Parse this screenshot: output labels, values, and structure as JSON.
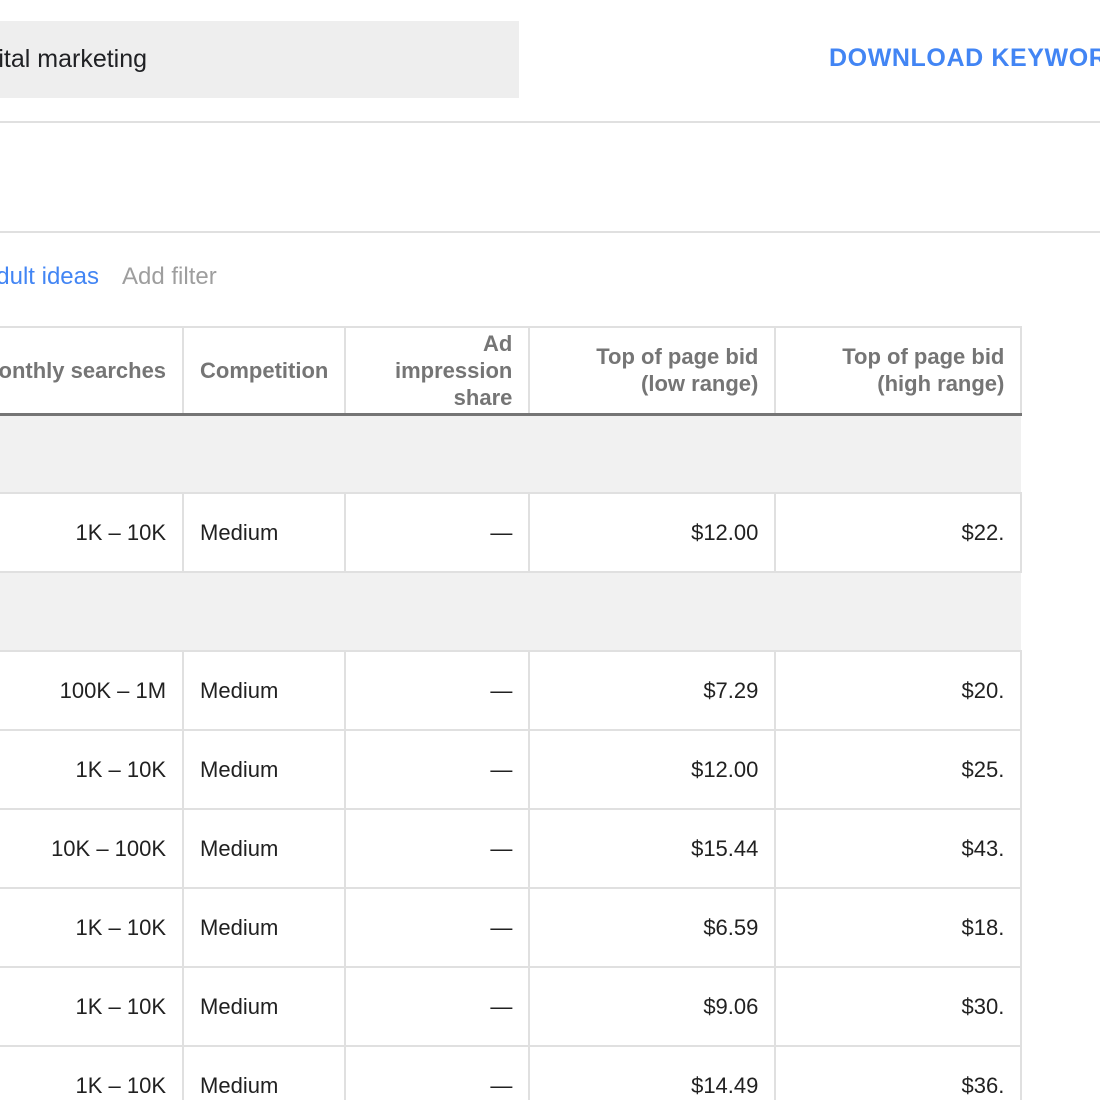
{
  "search": {
    "value": "digital marketing"
  },
  "toolbar": {
    "download_label": "DOWNLOAD KEYWORD IDEAS"
  },
  "filters": {
    "active_chip": "Exclude adult ideas",
    "add_filter_label": "Add filter"
  },
  "table": {
    "headers": {
      "searches": "Avg. monthly searches",
      "competition": "Competition",
      "impression_share": "Ad impression share",
      "bid_low": "Top of page bid (low range)",
      "bid_high": "Top of page bid (high range)"
    },
    "rows": [
      {
        "type": "group"
      },
      {
        "type": "data",
        "searches": "1K – 10K",
        "competition": "Medium",
        "impression_share": "—",
        "bid_low": "$12.00",
        "bid_high": "$22."
      },
      {
        "type": "group"
      },
      {
        "type": "data",
        "searches": "100K – 1M",
        "competition": "Medium",
        "impression_share": "—",
        "bid_low": "$7.29",
        "bid_high": "$20."
      },
      {
        "type": "data",
        "searches": "1K – 10K",
        "competition": "Medium",
        "impression_share": "—",
        "bid_low": "$12.00",
        "bid_high": "$25."
      },
      {
        "type": "data",
        "searches": "10K – 100K",
        "competition": "Medium",
        "impression_share": "—",
        "bid_low": "$15.44",
        "bid_high": "$43."
      },
      {
        "type": "data",
        "searches": "1K – 10K",
        "competition": "Medium",
        "impression_share": "—",
        "bid_low": "$6.59",
        "bid_high": "$18."
      },
      {
        "type": "data",
        "searches": "1K – 10K",
        "competition": "Medium",
        "impression_share": "—",
        "bid_low": "$9.06",
        "bid_high": "$30."
      },
      {
        "type": "data",
        "searches": "1K – 10K",
        "competition": "Medium",
        "impression_share": "—",
        "bid_low": "$14.49",
        "bid_high": "$36."
      }
    ]
  },
  "colors": {
    "accent": "#4285f4",
    "search_bg": "#eeeeee",
    "group_row_bg": "#f1f1f1",
    "header_text": "#757575",
    "muted_text": "#9e9e9e"
  }
}
